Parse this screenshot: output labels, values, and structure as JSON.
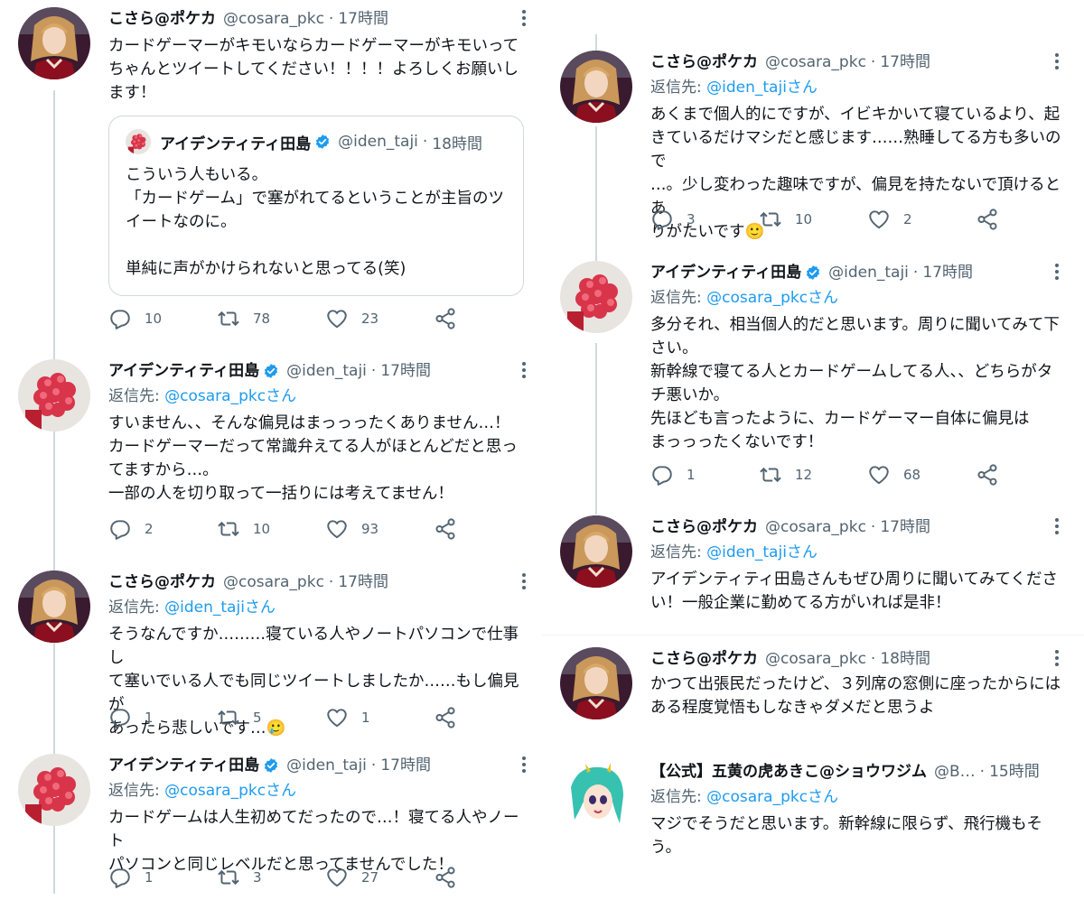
{
  "users": {
    "kosara": {
      "name": "こさら@ポケカ",
      "handle": "@cosara_pkc"
    },
    "iden": {
      "name": "アイデンティティ田島",
      "handle": "@iden_taji"
    },
    "akiko": {
      "name": "【公式】五黄の虎あきこ@ショウワジム",
      "handle": "@B…"
    }
  },
  "reply_prefix": "返信先:",
  "left": [
    {
      "time": "17時間",
      "text": "カードゲーマーがキモいならカードゲーマーがキモいって\nちゃんとツイートしてください！！！！よろしくお願いし\nます！",
      "quote": {
        "time": "18時間",
        "text": "こういう人もいる。\n「カードゲーム」で塞がれてるということが主旨のツ\nイートなのに。\n\n単純に声がかけられないと思ってる(笑)"
      },
      "stats": {
        "replies": "10",
        "retweets": "78",
        "likes": "23"
      }
    },
    {
      "time": "17時間",
      "reply_to": "@cosara_pkcさん",
      "text": "すいません、、そんな偏見はまっっったくありません…！\nカードゲーマーだって常識弁えてる人がほとんどだと思っ\nてますから…。\n一部の人を切り取って一括りには考えてません！",
      "stats": {
        "replies": "2",
        "retweets": "10",
        "likes": "93"
      }
    },
    {
      "time": "17時間",
      "reply_to": "@iden_tajiさん",
      "text": "そうなんですか………寝ている人やノートパソコンで仕事し\nて塞いでいる人でも同じツイートしましたか……もし偏見が\nあったら悲しいです…🥲",
      "stats": {
        "replies": "1",
        "retweets": "5",
        "likes": "1"
      }
    },
    {
      "time": "17時間",
      "reply_to": "@cosara_pkcさん",
      "text": "カードゲームは人生初めてだったので…！寝てる人やノート\nパソコンと同じレベルだと思ってませんでした！",
      "stats": {
        "replies": "1",
        "retweets": "3",
        "likes": "27"
      }
    }
  ],
  "right": [
    {
      "time": "17時間",
      "reply_to": "@iden_tajiさん",
      "text": "あくまで個人的にですが、イビキかいて寝ているより、起\nきているだけマシだと感じます……熟睡してる方も多いので\n…。少し変わった趣味ですが、偏見を持たないで頂けるとあ\nりがたいです🙂",
      "stats": {
        "replies": "3",
        "retweets": "10",
        "likes": "2"
      }
    },
    {
      "time": "17時間",
      "reply_to": "@cosara_pkcさん",
      "text": "多分それ、相当個人的だと思います。周りに聞いてみて下\nさい。\n新幹線で寝てる人とカードゲームしてる人、、どちらがタ\nチ悪いか。\n先ほども言ったように、カードゲーマー自体に偏見は\nまっっったくないです！",
      "stats": {
        "replies": "1",
        "retweets": "12",
        "likes": "68"
      }
    },
    {
      "time": "17時間",
      "reply_to": "@iden_tajiさん",
      "text": "アイデンティティ田島さんもぜひ周りに聞いてみてくださ\nい！一般企業に勤めてる方がいれば是非！"
    },
    {
      "time": "18時間",
      "text": "かつて出張民だったけど、３列席の窓側に座ったからには\nある程度覚悟もしなきゃダメだと思うよ"
    },
    {
      "time": "15時間",
      "reply_to": "@cosara_pkcさん",
      "text": "マジでそうだと思います。新幹線に限らず、飛行機もそ\nう。"
    }
  ],
  "colors": {
    "text": "#0f1419",
    "muted": "#536471",
    "link": "#1d9bf0",
    "border": "#cfd9de"
  }
}
